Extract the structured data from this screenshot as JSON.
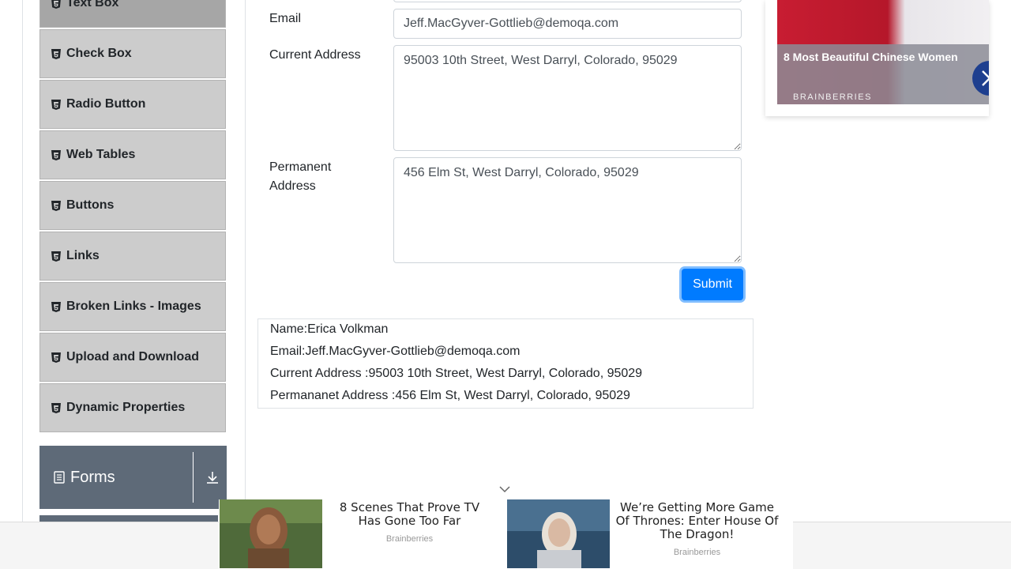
{
  "sidebar": {
    "items": [
      {
        "label": "Text Box"
      },
      {
        "label": "Check Box"
      },
      {
        "label": "Radio Button"
      },
      {
        "label": "Web Tables"
      },
      {
        "label": "Buttons"
      },
      {
        "label": "Links"
      },
      {
        "label": "Broken Links - Images"
      },
      {
        "label": "Upload and Download"
      },
      {
        "label": "Dynamic Properties"
      }
    ],
    "group": {
      "label": "Forms"
    }
  },
  "form": {
    "email_label": "Email",
    "email_value": "Jeff.MacGyver-Gottlieb@demoqa.com",
    "current_address_label": "Current Address",
    "current_address_value": "95003 10th Street, West Darryl, Colorado, 95029",
    "permanent_address_label_1": "Permanent",
    "permanent_address_label_2": "Address",
    "permanent_address_value": "456 Elm St, West Darryl, Colorado, 95029",
    "submit_label": "Submit"
  },
  "output": {
    "name": "Name:Erica Volkman",
    "email": "Email:Jeff.MacGyver-Gottlieb@demoqa.com",
    "current_address": "Current Address :95003 10th Street, West Darryl, Colorado, 95029",
    "permanent_address": "Permananet Address :456 Elm St, West Darryl, Colorado, 95029"
  },
  "ad_top": {
    "title": "8 Most Beautiful Chinese Women",
    "brand": "BRAINBERRIES"
  },
  "ad_bottom": {
    "cards": [
      {
        "title_1": "8 Scenes That Prove TV",
        "title_2": "Has Gone Too Far",
        "brand": "Brainberries"
      },
      {
        "title_1": "We’re Getting More Game",
        "title_2": "Of Thrones: Enter House Of",
        "title_3": "The Dragon!",
        "brand": "Brainberries"
      }
    ]
  },
  "colors": {
    "submit": "#007bff",
    "sidebar_item": "#cccccc",
    "sidebar_active": "#a6a6a6",
    "group_header": "#5e6a78"
  }
}
